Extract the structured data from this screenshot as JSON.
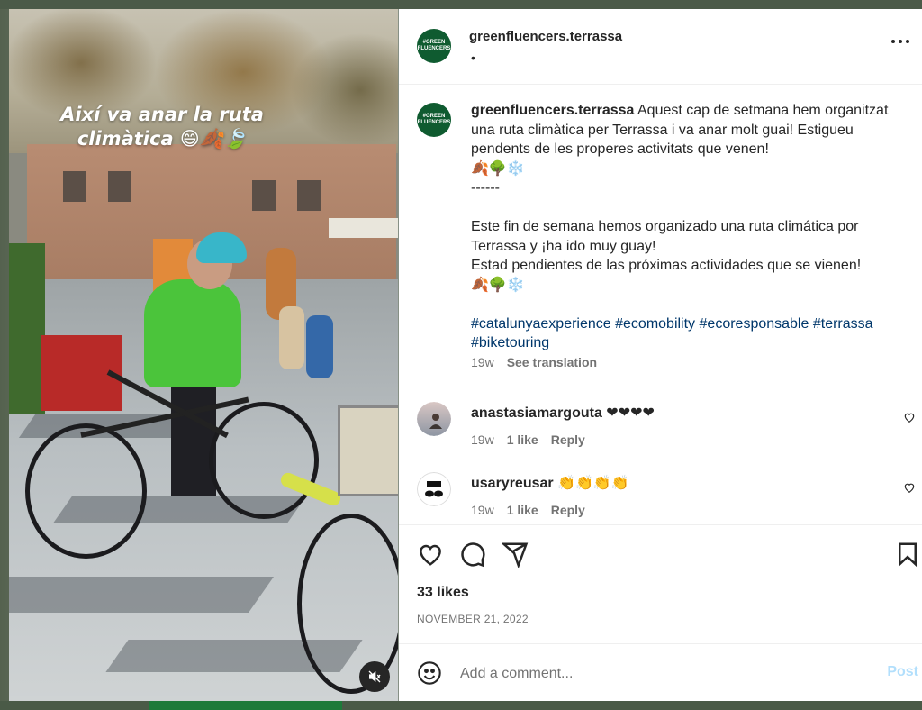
{
  "post": {
    "username": "greenfluencers.terrassa",
    "avatar_text": "#GREEN FLUENCERS",
    "header_dot": "•",
    "more_icon": "more-horizontal-icon"
  },
  "media": {
    "overlay_text": "Així va anar la ruta climàtica 😄🍂🍃",
    "mute_icon": "muted-speaker-icon"
  },
  "caption": {
    "username": "greenfluencers.terrassa",
    "text": " Aquest cap de setmana hem organitzat una ruta climàtica per Terrassa i va anar molt guai! Estigueu pendents de les properes activitats que venen!\n🍂🌳❄️\n------\n\nEste fin de semana hemos organizado una ruta climática por Terrassa y ¡ha ido muy guay!\nEstad pendientes de las próximas actividades que se vienen!\n🍂🌳❄️\n\n",
    "hashtags": [
      "#catalunyaexperience",
      "#ecomobility",
      "#ecoresponsable",
      "#terrassa",
      "#biketouring"
    ],
    "time": "19w",
    "see_translation": "See translation"
  },
  "comments": [
    {
      "username": "anastasiamargouta",
      "text": "❤❤❤❤",
      "time": "19w",
      "likes": "1 like",
      "reply": "Reply"
    },
    {
      "username": "usaryreusar",
      "text": "👏👏👏👏",
      "time": "19w",
      "likes": "1 like",
      "reply": "Reply"
    }
  ],
  "actions": {
    "likes": "33 likes",
    "date": "NOVEMBER 21, 2022"
  },
  "add_comment": {
    "placeholder": "Add a comment...",
    "post_label": "Post"
  },
  "colors": {
    "brand_green": "#0f5b30",
    "link_blue": "#00376b",
    "post_disabled": "#b2dffc"
  }
}
